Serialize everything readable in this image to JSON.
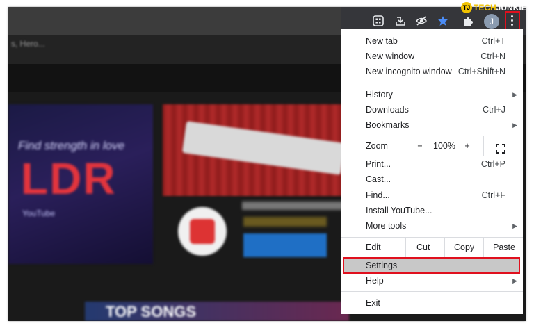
{
  "background": {
    "crumb": "s, Hero...",
    "thumb_tagline": "Find strength in love",
    "thumb_title": "LDR",
    "thumb_sub": "YouTube",
    "bottom_banner": "TOP SONGS"
  },
  "watermark": {
    "part1": "TECH",
    "part2": "JUNKIE",
    "badge": "TJ"
  },
  "toolbar": {
    "icons": [
      "grid-icon",
      "download-icon",
      "eye-off-icon",
      "star-icon",
      "puzzle-icon"
    ],
    "avatar_letter": "J",
    "accent_star": "#4b8cf5",
    "highlight": "#e0101e"
  },
  "menu": {
    "new_tab": {
      "label": "New tab",
      "shortcut": "Ctrl+T"
    },
    "new_window": {
      "label": "New window",
      "shortcut": "Ctrl+N"
    },
    "new_incognito": {
      "label": "New incognito window",
      "shortcut": "Ctrl+Shift+N"
    },
    "history": {
      "label": "History"
    },
    "downloads": {
      "label": "Downloads",
      "shortcut": "Ctrl+J"
    },
    "bookmarks": {
      "label": "Bookmarks"
    },
    "zoom": {
      "label": "Zoom",
      "minus": "−",
      "value": "100%",
      "plus": "+"
    },
    "print": {
      "label": "Print...",
      "shortcut": "Ctrl+P"
    },
    "cast": {
      "label": "Cast..."
    },
    "find": {
      "label": "Find...",
      "shortcut": "Ctrl+F"
    },
    "install": {
      "label": "Install YouTube..."
    },
    "more_tools": {
      "label": "More tools"
    },
    "edit": {
      "label": "Edit",
      "cut": "Cut",
      "copy": "Copy",
      "paste": "Paste"
    },
    "settings": {
      "label": "Settings"
    },
    "help": {
      "label": "Help"
    },
    "exit": {
      "label": "Exit"
    }
  }
}
